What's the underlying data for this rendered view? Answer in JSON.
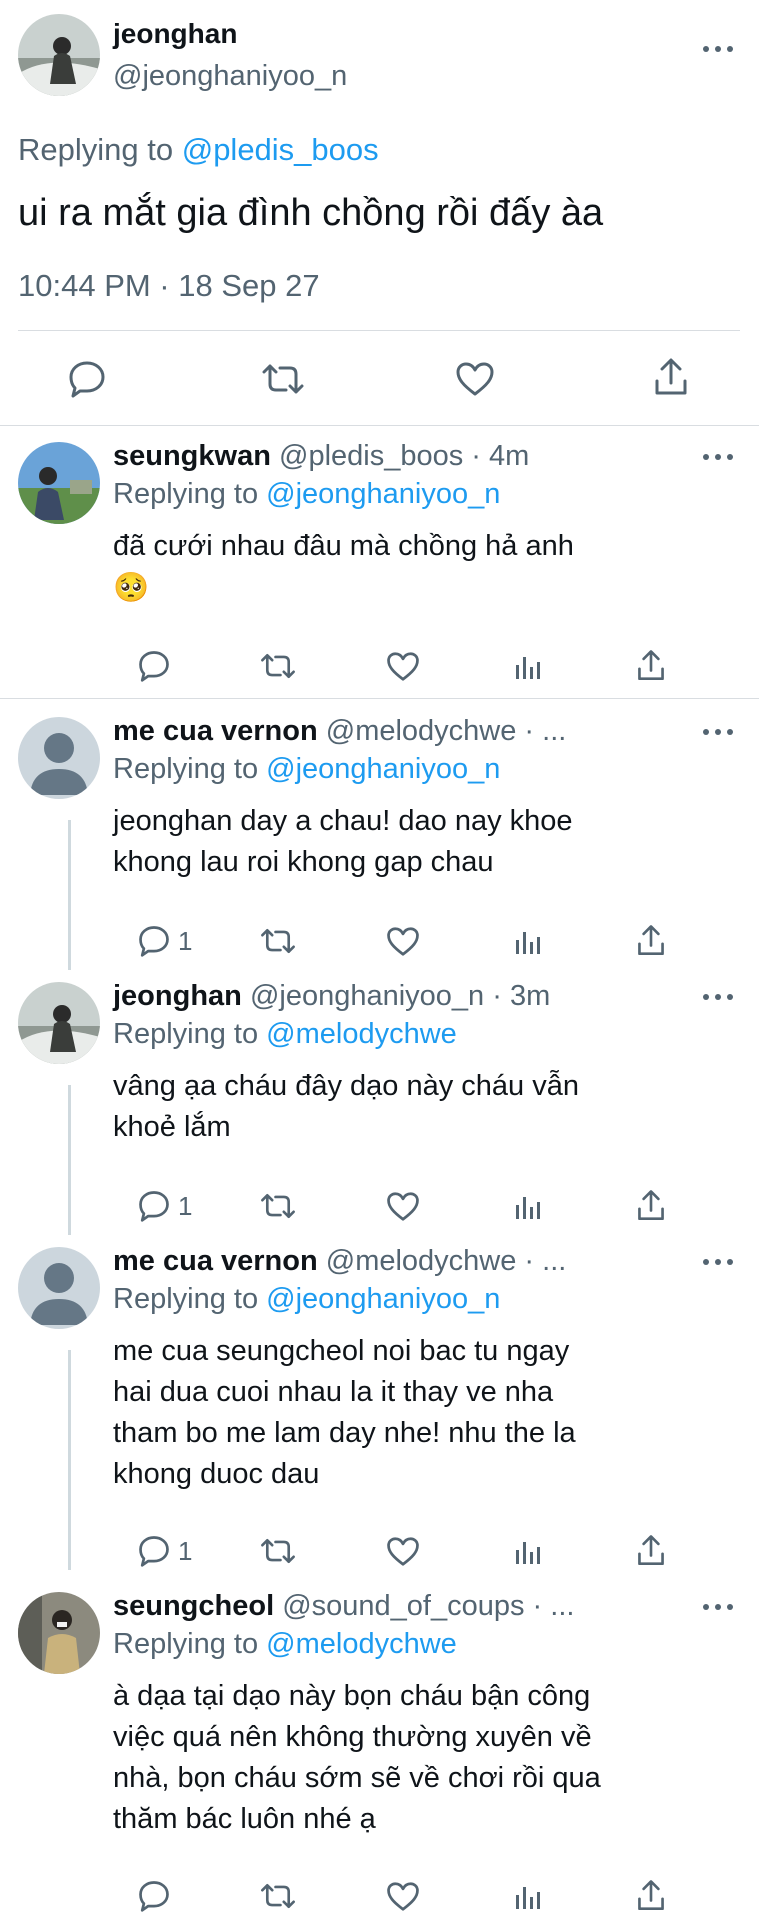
{
  "main_tweet": {
    "name": "jeonghan",
    "handle": "@jeonghaniyoo_n",
    "replying_prefix": "Replying to",
    "replying_to": "@pledis_boos",
    "text": "ui ra mắt gia đình chồng rồi đấy àa",
    "timestamp": "10:44 PM · 18 Sep 27"
  },
  "replies": [
    {
      "name": "seungkwan",
      "handle_meta": "@pledis_boos · 4m",
      "replying_prefix": "Replying to",
      "replying_to": "@jeonghaniyoo_n",
      "lines": [
        "đã cưới nhau đâu mà chồng hả anh",
        "🥺"
      ],
      "reply_count": ""
    },
    {
      "name": "me cua vernon",
      "handle_meta": "@melodychwe · ...",
      "replying_prefix": "Replying to",
      "replying_to": "@jeonghaniyoo_n",
      "lines": [
        "jeonghan day a chau! dao nay khoe",
        "khong lau roi khong gap chau"
      ],
      "reply_count": "1"
    },
    {
      "name": "jeonghan",
      "handle_meta": "@jeonghaniyoo_n · 3m",
      "replying_prefix": "Replying to",
      "replying_to": "@melodychwe",
      "lines": [
        "vâng ạa cháu đây dạo này cháu vẫn",
        "khoẻ lắm"
      ],
      "reply_count": "1"
    },
    {
      "name": "me cua vernon",
      "handle_meta": "@melodychwe · ...",
      "replying_prefix": "Replying to",
      "replying_to": "@jeonghaniyoo_n",
      "lines": [
        "me cua seungcheol noi bac tu ngay",
        "hai dua cuoi nhau la it thay ve nha",
        "tham bo me lam day nhe! nhu the la",
        "khong duoc dau"
      ],
      "reply_count": "1"
    },
    {
      "name": "seungcheol",
      "handle_meta": "@sound_of_coups · ...",
      "replying_prefix": "Replying to",
      "replying_to": "@melodychwe",
      "lines": [
        "à dạa tại dạo này bọn cháu bận công",
        "việc quá nên không thường xuyên về",
        "nhà, bọn cháu sớm sẽ về chơi rồi qua",
        "thăm bác luôn nhé ạ"
      ],
      "reply_count": ""
    }
  ],
  "icons": [
    "reply-icon",
    "retweet-icon",
    "like-icon",
    "analytics-icon",
    "share-icon",
    "more-icon"
  ],
  "colors": {
    "text": "#0f1419",
    "secondary": "#536471",
    "link": "#1d9bf0",
    "divider": "#d9dde1"
  }
}
